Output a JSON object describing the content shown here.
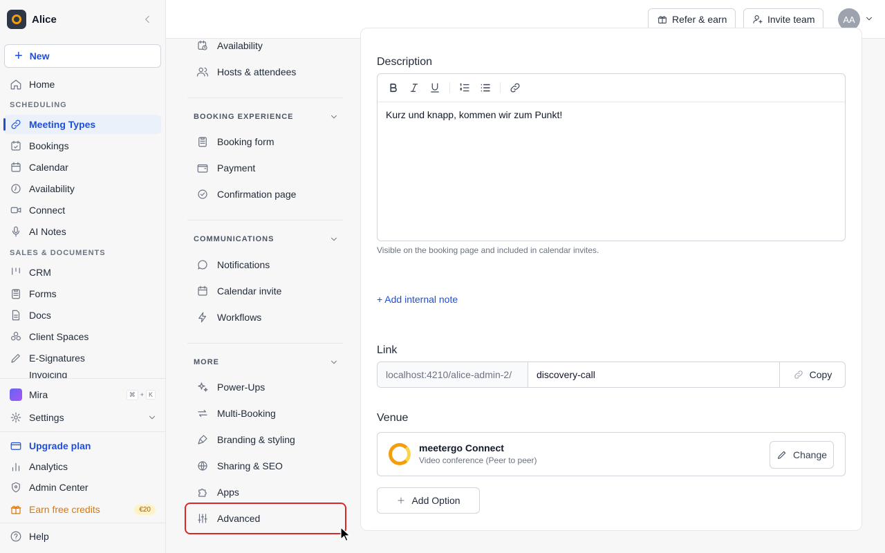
{
  "workspace": {
    "name": "Alice"
  },
  "sidebar": {
    "new_label": "New",
    "home": "Home",
    "section_scheduling": "SCHEDULING",
    "meeting_types": "Meeting Types",
    "bookings": "Bookings",
    "calendar": "Calendar",
    "availability": "Availability",
    "connect": "Connect",
    "ai_notes": "AI Notes",
    "section_sales": "SALES & DOCUMENTS",
    "crm": "CRM",
    "forms": "Forms",
    "docs": "Docs",
    "client_spaces": "Client Spaces",
    "e_signatures": "E-Signatures",
    "invoicing_partial": "Invoicing",
    "mira": "Mira",
    "mira_shortcut_1": "⌘",
    "mira_shortcut_2": "+",
    "mira_shortcut_3": "K",
    "settings": "Settings",
    "upgrade": "Upgrade plan",
    "analytics": "Analytics",
    "admin_center": "Admin Center",
    "earn_credits": "Earn free credits",
    "earn_badge": "€20",
    "help": "Help"
  },
  "topbar": {
    "refer": "Refer & earn",
    "invite": "Invite team",
    "avatar_initials": "AA"
  },
  "settings_menu": {
    "availability": "Availability",
    "hosts": "Hosts & attendees",
    "section_booking": "BOOKING EXPERIENCE",
    "booking_form": "Booking form",
    "payment": "Payment",
    "confirmation": "Confirmation page",
    "section_comms": "COMMUNICATIONS",
    "notifications": "Notifications",
    "calendar_invite": "Calendar invite",
    "workflows": "Workflows",
    "section_more": "MORE",
    "power_ups": "Power-Ups",
    "multi_booking": "Multi-Booking",
    "branding": "Branding & styling",
    "sharing": "Sharing & SEO",
    "apps": "Apps",
    "advanced": "Advanced"
  },
  "form": {
    "description_label": "Description",
    "description_text": "Kurz und knapp, kommen wir zum Punkt!",
    "description_hint": "Visible on the booking page and included in calendar invites.",
    "internal_note": "+ Add internal note",
    "link_label": "Link",
    "link_prefix": "localhost:4210/alice-admin-2/",
    "link_slug": "discovery-call",
    "copy": "Copy",
    "venue_label": "Venue",
    "venue_title": "meetergo Connect",
    "venue_sub": "Video conference (Peer to peer)",
    "change": "Change",
    "add_option": "Add Option"
  },
  "colors": {
    "accent": "#1d4ed8",
    "highlight": "#dc2626",
    "credits": "#d97706"
  }
}
